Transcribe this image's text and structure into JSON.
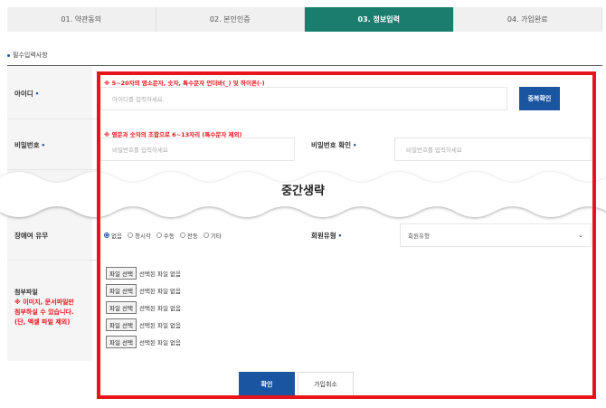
{
  "steps": [
    {
      "label": "01. 약관동의",
      "active": false
    },
    {
      "label": "02. 본인인증",
      "active": false
    },
    {
      "label": "03. 정보입력",
      "active": true
    },
    {
      "label": "04. 가입완료",
      "active": false
    }
  ],
  "section_caption": "필수입력사항",
  "colors": {
    "accent_green": "#1b7d6d",
    "primary_blue": "#1a55a2",
    "highlight_red": "#e8141b"
  },
  "form": {
    "id_label": "아이디",
    "id_hint": "※ 5~20자의 영소문자, 숫자, 특수문자 언더바(_) 및 하이픈(-)",
    "id_placeholder": "아이디를 입력하세요.",
    "dup_check_label": "중복확인",
    "pw_label": "비밀번호",
    "pw_hint": "※ 영문과 숫자의 조합으로 6~13자리 (특수문자 제외)",
    "pw_placeholder": "비밀번호를 입력하세요",
    "pw_confirm_label": "비밀번호 확인",
    "pw_confirm_placeholder": "비밀번호를 입력하세요",
    "omitted_text": "중간생략",
    "disability_label": "장애여 유무",
    "disability_options": [
      "없음",
      "청시각",
      "수동",
      "전동",
      "기타"
    ],
    "disability_selected": "없음",
    "member_type_label": "회원유형",
    "member_type_value": "회원유형",
    "attachment_title": "첨부파일",
    "attachment_note_1": "※ 이미지, 문서파일만",
    "attachment_note_2": "첨부하실 수 있습니다.",
    "attachment_note_3": "(단, 엑셀 파일 제외)",
    "file_inputs": [
      {
        "button": "파일 선택",
        "status": "선택된 파일 없음"
      },
      {
        "button": "파일 선택",
        "status": "선택된 파일 없음"
      },
      {
        "button": "파일 선택",
        "status": "선택된 파일 없음"
      },
      {
        "button": "파일 선택",
        "status": "선택된 파일 없음"
      },
      {
        "button": "파일 선택",
        "status": "선택된 파일 없음"
      }
    ],
    "confirm_label": "확인",
    "cancel_label": "가입취소"
  }
}
